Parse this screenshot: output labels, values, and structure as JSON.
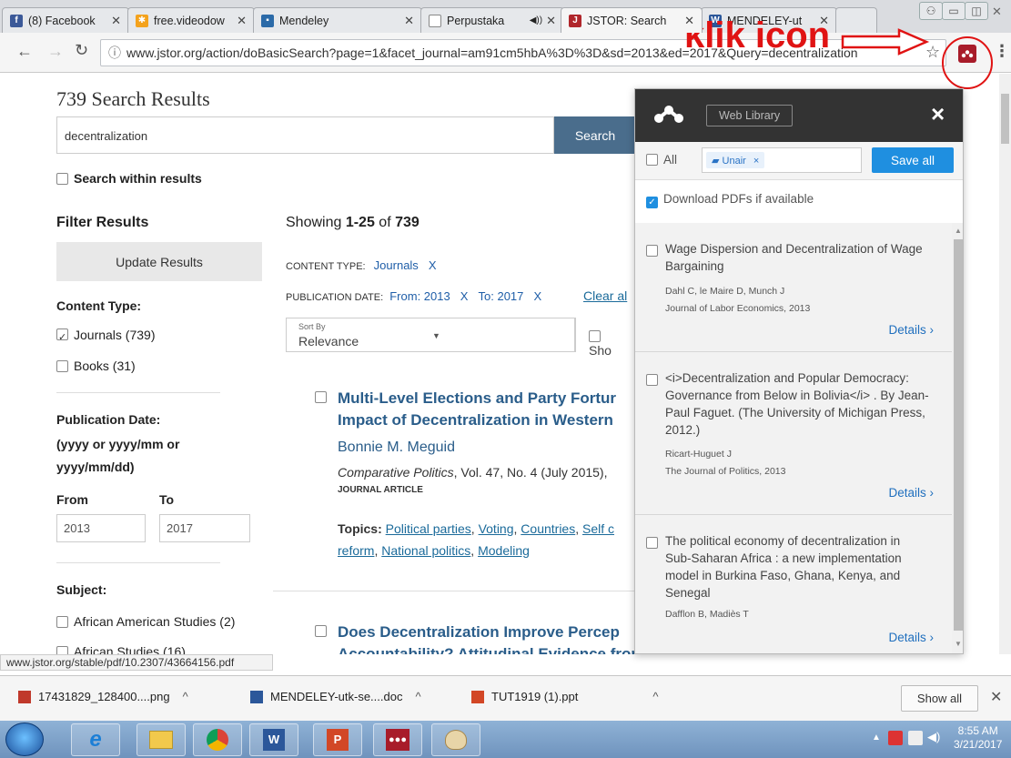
{
  "browser": {
    "tabs": [
      {
        "label": "(8) Facebook",
        "icon": "facebook-icon"
      },
      {
        "label": "free.videodow",
        "icon": "video-icon"
      },
      {
        "label": "Mendeley",
        "icon": "mendeley-icon"
      },
      {
        "label": "Perpustaka",
        "icon": "page-icon"
      },
      {
        "label": "JSTOR: Search",
        "icon": "jstor-icon"
      },
      {
        "label": "MENDELEY-ut",
        "icon": "word-icon"
      }
    ],
    "url": "www.jstor.org/action/doBasicSearch?page=1&facet_journal=am91cm5hbA%3D%3D&sd=2013&ed=2017&Query=decentralization",
    "annotation": "klik icon"
  },
  "jstor": {
    "results_heading": "739 Search Results",
    "search_value": "decentralization",
    "search_button": "Search",
    "search_within": "Search within results",
    "filter_heading": "Filter Results",
    "update_button": "Update Results",
    "content_type_label": "Content Type:",
    "content_types": [
      "Journals (739)",
      "Books (31)"
    ],
    "pub_date_label": "Publication Date:",
    "pub_date_hint1": "(yyyy or yyyy/mm or",
    "pub_date_hint2": "yyyy/mm/dd)",
    "from_label": "From",
    "to_label": "To",
    "from_value": "2013",
    "to_value": "2017",
    "subject_label": "Subject:",
    "subjects": [
      "African American Studies (2)",
      "African Studies (16)"
    ],
    "showing_prefix": "Showing ",
    "showing_range": "1-25",
    "showing_of": " of ",
    "showing_total": "739",
    "content_type_chip_label": "CONTENT TYPE:",
    "content_type_chip": "Journals",
    "chip_x": "X",
    "pub_date_chip_label": "PUBLICATION DATE:",
    "pub_from": "From: 2013",
    "pub_to": "To: 2017",
    "clear_all": "Clear al",
    "sort_label": "Sort By",
    "sort_value": "Relevance",
    "show_label": "Sho",
    "results": [
      {
        "title_line1": "Multi-Level Elections and Party Fortur",
        "title_line2": "Impact of Decentralization in Western",
        "author": "Bonnie M. Meguid",
        "journal": "Comparative Politics",
        "citation": ", Vol. 47, No. 4 (July 2015),",
        "type": "JOURNAL ARTICLE",
        "topics_label": "Topics:",
        "topics": [
          "Political parties",
          "Voting",
          "Countries",
          "Self c",
          "reform",
          "National politics",
          "Modeling"
        ]
      },
      {
        "title_line1": "Does Decentralization Improve Percep",
        "title_line2": "Accountability? Attitudinal Evidence from Colombia"
      }
    ]
  },
  "mendeley": {
    "web_library": "Web Library",
    "close": "×",
    "all_label": "All",
    "group_tag": "Unair",
    "save_all": "Save all",
    "download_pdfs": "Download PDFs if available",
    "details": "Details",
    "items": [
      {
        "title": "Wage Dispersion and Decentralization of Wage Bargaining",
        "authors": "Dahl C,  le Maire D,  Munch J",
        "source": "Journal of Labor Economics, 2013"
      },
      {
        "title": "<i>Decentralization and Popular Democracy: Governance from Below in Bolivia</i> . By Jean-Paul Faguet. (The University of Michigan Press, 2012.)",
        "authors": "Ricart-Huguet J",
        "source": "The Journal of Politics, 2013"
      },
      {
        "title": "The political economy of decentralization in Sub-Saharan Africa : a new implementation model in Burkina Faso, Ghana, Kenya, and Senegal",
        "authors": "Dafflon B,  Madiès T",
        "source": ""
      }
    ]
  },
  "statusbar": "www.jstor.org/stable/pdf/10.2307/43664156.pdf",
  "downloads": [
    {
      "name": "17431829_128400....png",
      "icon": "image-file-icon"
    },
    {
      "name": "MENDELEY-utk-se....doc",
      "icon": "word-file-icon"
    },
    {
      "name": "TUT1919 (1).ppt",
      "icon": "ppt-file-icon"
    }
  ],
  "downloads_show_all": "Show all",
  "taskbar": {
    "time": "8:55 AM",
    "date": "3/21/2017",
    "apps": [
      "start-orb-icon",
      "internet-explorer-icon",
      "file-explorer-icon",
      "chrome-icon",
      "word-icon",
      "powerpoint-icon",
      "mendeley-icon",
      "paint-icon"
    ]
  },
  "colors": {
    "annotation_red": "#e01313",
    "jstor_button": "#4a6d8c",
    "mendeley_header": "#333333",
    "mendeley_blue": "#1f8fe0",
    "mendeley_brand": "#a81c2a"
  }
}
